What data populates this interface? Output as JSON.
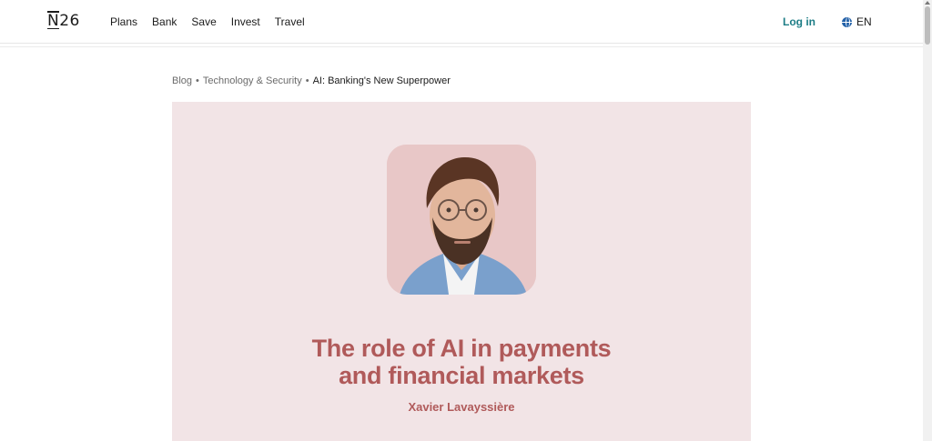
{
  "header": {
    "logo": "N26",
    "nav": [
      "Plans",
      "Bank",
      "Save",
      "Invest",
      "Travel"
    ],
    "login_label": "Log in",
    "language_label": "EN",
    "login_color": "#1d7d86"
  },
  "breadcrumb": {
    "items": [
      "Blog",
      "Technology & Security",
      "AI: Banking's New Superpower"
    ],
    "separator": "•"
  },
  "hero": {
    "title_line1": "The role of AI in payments",
    "title_line2": "and financial markets",
    "author": "Xavier Lavayssière",
    "background": "#f2e4e6",
    "accent": "#b05a5a"
  }
}
